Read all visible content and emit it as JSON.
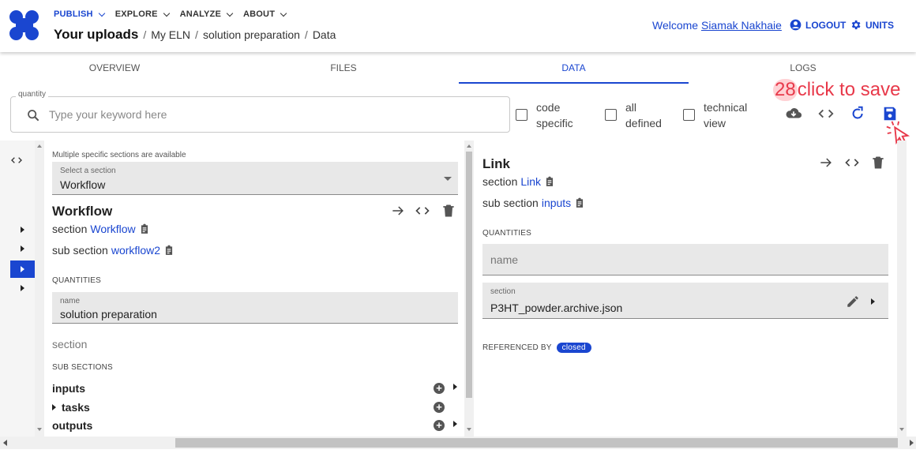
{
  "header": {
    "nav": [
      {
        "label": "PUBLISH",
        "active": true
      },
      {
        "label": "EXPLORE",
        "active": false
      },
      {
        "label": "ANALYZE",
        "active": false
      },
      {
        "label": "ABOUT",
        "active": false
      }
    ],
    "breadcrumb": {
      "root": "Your uploads",
      "items": [
        "My ELN",
        "solution preparation",
        "Data"
      ],
      "separator": "/"
    },
    "welcome_prefix": "Welcome",
    "user_name": "Siamak Nakhaie",
    "logout_label": "LOGOUT",
    "units_label": "UNITS"
  },
  "tabs": [
    {
      "label": "OVERVIEW",
      "active": false
    },
    {
      "label": "FILES",
      "active": false
    },
    {
      "label": "DATA",
      "active": true
    },
    {
      "label": "LOGS",
      "active": false
    }
  ],
  "search": {
    "legend": "quantity",
    "placeholder": "Type your keyword here",
    "value": ""
  },
  "filters": [
    {
      "line1": "code",
      "line2": "specific",
      "checked": false
    },
    {
      "line1": "all",
      "line2": "defined",
      "checked": false
    },
    {
      "line1": "technical",
      "line2": "view",
      "checked": false
    }
  ],
  "annotation": {
    "number": "28",
    "text": "click to save"
  },
  "left_pane": {
    "hint": "Multiple specific sections are available",
    "select_label": "Select a section",
    "select_value": "Workflow",
    "title": "Workflow",
    "section_prefix": "section",
    "section_link": "Workflow",
    "subsection_prefix": "sub section",
    "subsection_link": "workflow2",
    "quantities_heading": "QUANTITIES",
    "name_label": "name",
    "name_value": "solution preparation",
    "section_field": "section",
    "subsections_heading": "SUB SECTIONS",
    "subsections": [
      {
        "label": "inputs",
        "expandable": false
      },
      {
        "label": "tasks",
        "expandable": true
      },
      {
        "label": "outputs",
        "expandable": false
      }
    ]
  },
  "right_pane": {
    "title": "Link",
    "section_prefix": "section",
    "section_link": "Link",
    "subsection_prefix": "sub section",
    "subsection_link": "inputs",
    "quantities_heading": "QUANTITIES",
    "name_placeholder": "name",
    "section_label": "section",
    "section_value": "P3HT_powder.archive.json",
    "referenced_by_label": "REFERENCED BY",
    "referenced_by_chip": "closed"
  },
  "colors": {
    "accent": "#1a46d0",
    "annotation": "#e8394a"
  }
}
